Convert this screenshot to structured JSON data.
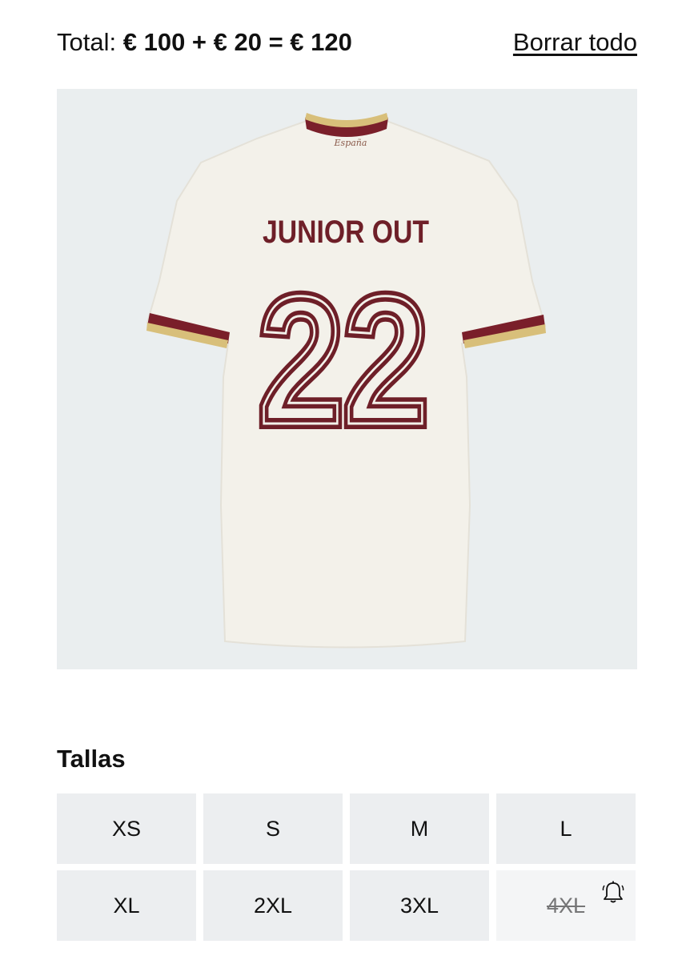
{
  "header": {
    "total_label": "Total:",
    "total_sum": "€ 100 + € 20 = € 120",
    "clear_all": "Borrar todo"
  },
  "product": {
    "crest_text": "España",
    "print_name": "JUNIOR OUT",
    "print_number": "22",
    "shirt_color": "#f3f1ea",
    "trim_maroon": "#7a1f2a",
    "trim_gold": "#d8bf7a"
  },
  "sizes": {
    "heading": "Tallas",
    "options": [
      {
        "label": "XS",
        "available": true
      },
      {
        "label": "S",
        "available": true
      },
      {
        "label": "M",
        "available": true
      },
      {
        "label": "L",
        "available": true
      },
      {
        "label": "XL",
        "available": true
      },
      {
        "label": "2XL",
        "available": true
      },
      {
        "label": "3XL",
        "available": true
      },
      {
        "label": "4XL",
        "available": false,
        "icon": "bell-icon"
      }
    ]
  }
}
